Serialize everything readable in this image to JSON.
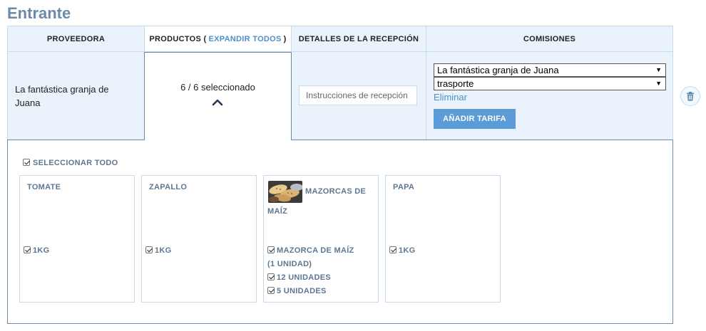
{
  "page_title": "Entrante",
  "headers": {
    "supplier": "PROVEEDORA",
    "products_prefix": "PRODUCTOS (",
    "expand_all": "EXPANDIR TODOS",
    "products_suffix": ")",
    "reception": "DETALLES DE LA RECEPCIÓN",
    "fees": "COMISIONES"
  },
  "row": {
    "supplier": "La fantástica granja de Juana",
    "selected_count": "6 / 6 seleccionado",
    "reception_placeholder": "Instrucciones de recepción",
    "fee_supplier_select": "La fantástica granja de Juana",
    "fee_type_select": "trasporte",
    "remove_link": "Eliminar",
    "add_fee_button": "AÑADIR TARIFA"
  },
  "products_panel": {
    "select_all": "SELECCIONAR TODO",
    "select_all_checked": true,
    "products": [
      {
        "name": "TOMATE",
        "options": [
          {
            "label": "1KG",
            "checked": true
          }
        ]
      },
      {
        "name": "ZAPALLO",
        "options": [
          {
            "label": "1KG",
            "checked": true
          }
        ]
      },
      {
        "name_line1": "MAZORCAS DE",
        "name_line2": "MAÍZ",
        "has_image": true,
        "options": [
          {
            "label_line1": "MAZORCA DE MAÍZ",
            "label_line2": "(1 UNIDAD)",
            "checked": true
          },
          {
            "label": "12 UNIDADES",
            "checked": true
          },
          {
            "label": "5 UNIDADES",
            "checked": true
          }
        ]
      },
      {
        "name": "PAPA",
        "options": [
          {
            "label": "1KG",
            "checked": true
          }
        ]
      }
    ]
  },
  "colors": {
    "title": "#6a8aa8",
    "header_bg": "#eaf3fc",
    "accent_link": "#4d8fc6",
    "button": "#5b9bd8",
    "product_text": "#5d7791"
  }
}
